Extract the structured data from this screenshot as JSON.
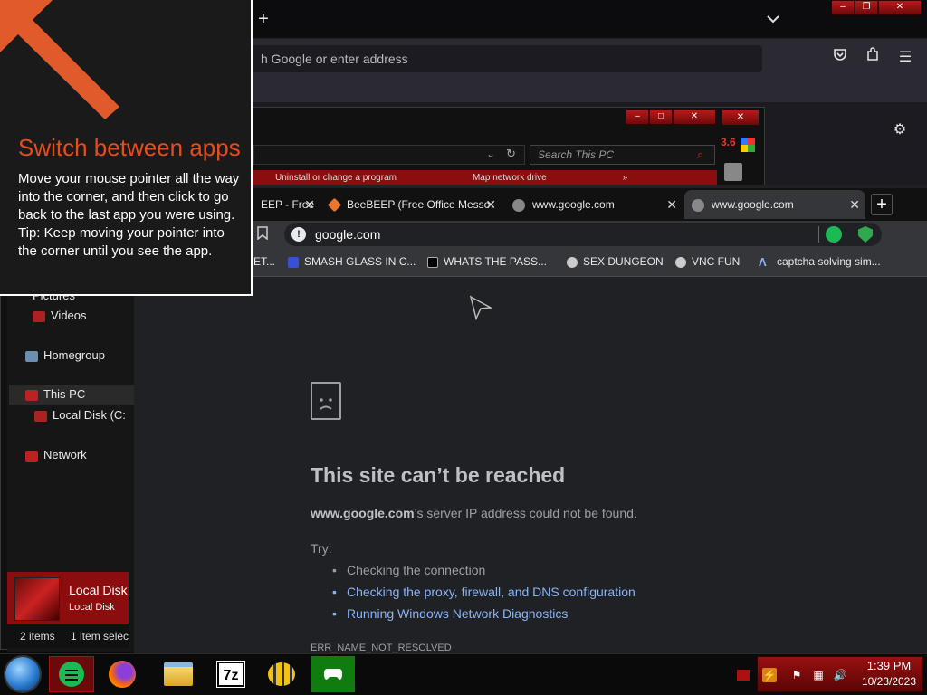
{
  "firefox": {
    "new_tab": "+",
    "list_tabs": "⌄",
    "url_placeholder": "Search with Google or enter address",
    "url_visible": "h Google or enter address"
  },
  "explorer": {
    "search_placeholder": "Search This PC",
    "ribbon_item_1": "Uninstall or change a program",
    "ribbon_item_2": "Map network drive",
    "ribbon_more": "»",
    "nav": {
      "pictures": "Pictures",
      "videos": "Videos",
      "homegroup": "Homegroup",
      "this_pc": "This PC",
      "local_disk": "Local Disk (C:",
      "network": "Network"
    },
    "details_name": "Local Disk",
    "details_type": "Local Disk",
    "status_items": "2 items",
    "status_selected": "1 item selec",
    "partial_label": "3.6"
  },
  "chrome": {
    "tabs": [
      {
        "label": "EEP - Free"
      },
      {
        "label": "BeeBEEP (Free Office Messe"
      },
      {
        "label": "www.google.com"
      },
      {
        "label": "www.google.com"
      }
    ],
    "new_tab": "+",
    "omnibox": "google.com",
    "bookmarks": [
      {
        "label": "ET..."
      },
      {
        "label": "SMASH GLASS IN C..."
      },
      {
        "label": "WHATS THE PASS..."
      },
      {
        "label": "SEX DUNGEON"
      },
      {
        "label": "VNC FUN"
      },
      {
        "label": "captcha solving sim..."
      }
    ],
    "error": {
      "title": "This site can’t be reached",
      "host": "www.google.com",
      "desc_rest": "’s server IP address could not be found.",
      "try": "Try:",
      "items": [
        "Checking the connection",
        "Checking the proxy, firewall, and DNS configuration",
        "Running Windows Network Diagnostics"
      ],
      "code": "ERR_NAME_NOT_RESOLVED"
    }
  },
  "tip": {
    "title": "Switch between apps",
    "body": "Move your mouse pointer all the way into the corner, and then click to go back to the last app you were using.",
    "tip": "Tip: Keep moving your pointer into the corner until you see the app."
  },
  "taskbar": {
    "apps": [
      "chat-app",
      "firefox",
      "file-explorer",
      "7zip",
      "beebeep",
      "xbox"
    ],
    "seven_zip_label": "7z",
    "clock_time": "1:39 PM",
    "clock_date": "10/23/2023"
  },
  "colors": {
    "accent_red": "#8b0d0d",
    "tip_title": "#e64c1e",
    "link_blue": "#8ab4f8"
  }
}
